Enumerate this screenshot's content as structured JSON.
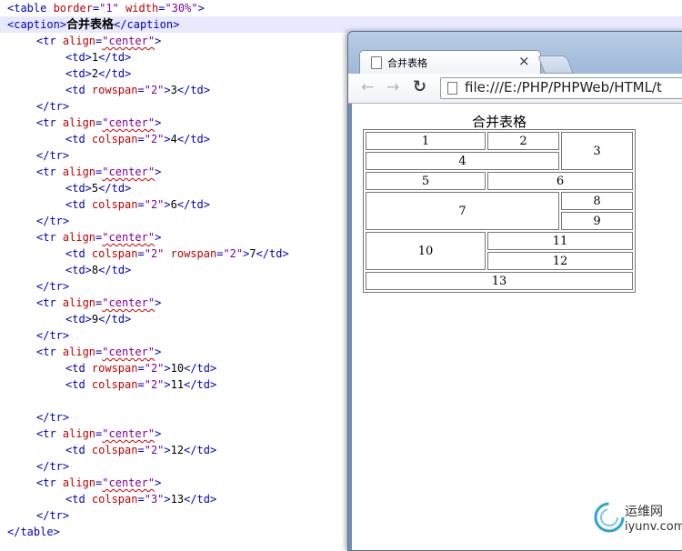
{
  "code": {
    "line1": {
      "open": "<table",
      "attr1": " border",
      "eq1": "=",
      "val1": "\"1\"",
      "attr2": " width",
      "eq2": "=",
      "val2": "\"30%\"",
      "close": ">"
    },
    "line2": {
      "open": "<caption>",
      "text": "合并表格",
      "close": "</caption>"
    },
    "tr_open_prefix": "<tr",
    "tr_attr": " align",
    "tr_eq": "=",
    "tr_val": "\"center\"",
    "tr_open_suffix": ">",
    "tr_close": "</tr>",
    "table_close": "</table>",
    "td_open": "<td>",
    "td_open_prefix": "<td",
    "td_close": "</td>",
    "gt": ">",
    "rowspan": " rowspan",
    "colspan": " colspan",
    "eq": "=",
    "two": "\"2\"",
    "three": "\"3\"",
    "cells": {
      "c1": "1",
      "c2": "2",
      "c3": "3",
      "c4": "4",
      "c5": "5",
      "c6": "6",
      "c7": "7",
      "c8": "8",
      "c9": "9",
      "c10": "10",
      "c11": "11",
      "c12": "12",
      "c13": "13"
    }
  },
  "browser": {
    "tab_title": "合并表格",
    "tab_close": "×",
    "back_icon": "←",
    "forward_icon": "→",
    "reload_icon": "↻",
    "url": "file:///E:/PHP/PHPWeb/HTML/t",
    "caption": "合并表格",
    "table": {
      "c1": "1",
      "c2": "2",
      "c3": "3",
      "c4": "4",
      "c5": "5",
      "c6": "6",
      "c7": "7",
      "c8": "8",
      "c9": "9",
      "c10": "10",
      "c11": "11",
      "c12": "12",
      "c13": "13"
    }
  },
  "watermark": {
    "cn": "运维网",
    "en": "iyunv.com"
  },
  "icons": {
    "tab": "page-icon",
    "address": "page-icon",
    "back": "back-arrow-icon",
    "forward": "forward-arrow-icon",
    "reload": "reload-icon",
    "close": "close-icon"
  }
}
